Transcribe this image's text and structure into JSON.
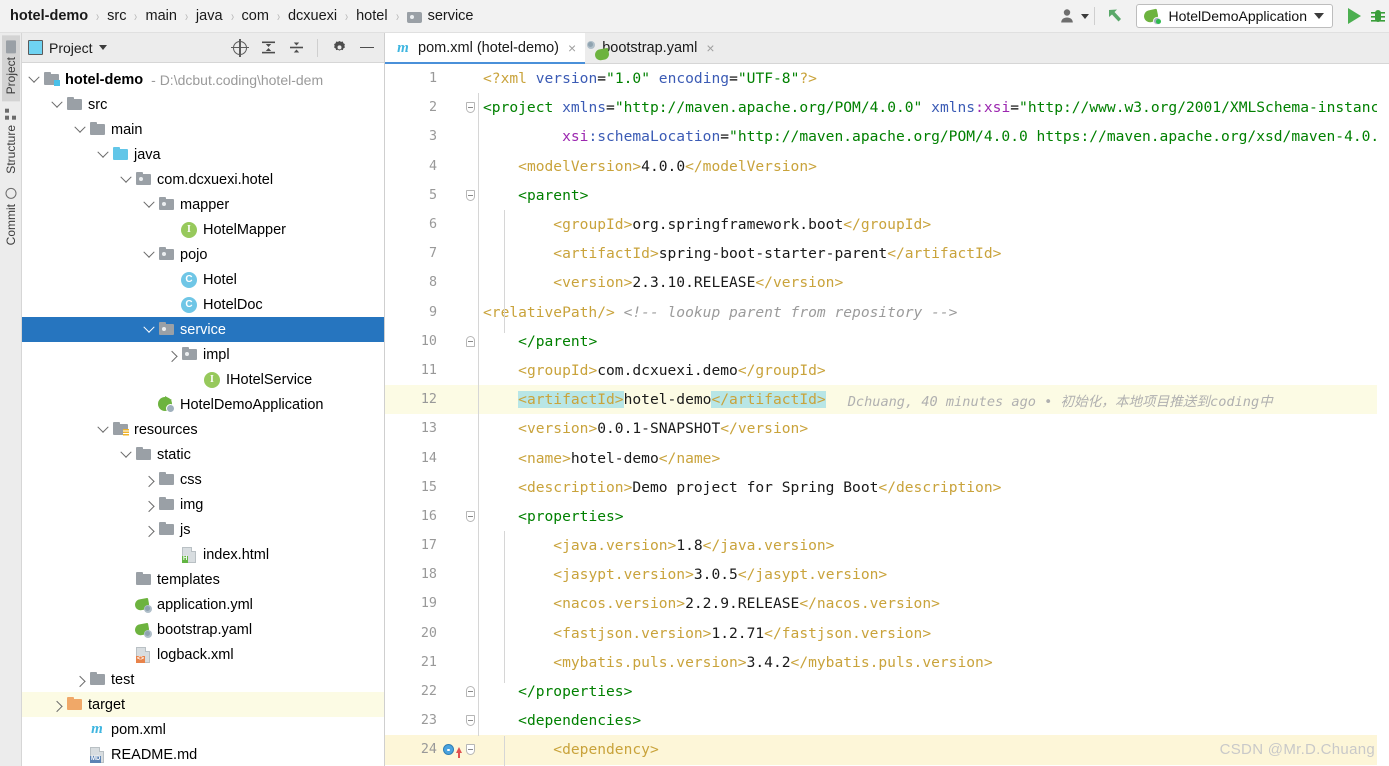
{
  "breadcrumb": {
    "items": [
      "hotel-demo",
      "src",
      "main",
      "java",
      "com",
      "dcxuexi",
      "hotel",
      "service"
    ],
    "separator": "›"
  },
  "toolbar": {
    "account_icon": "user-icon",
    "vcs_update_icon": "vcs-update-arrow-icon",
    "run_config_name": "HotelDemoApplication",
    "run_config_icon": "spring-boot-icon",
    "run_icon": "run-play-icon",
    "debug_icon": "debug-bug-icon"
  },
  "tool_strip": {
    "tabs": [
      {
        "label": "Project",
        "icon": "folder-icon",
        "active": true
      },
      {
        "label": "Structure",
        "icon": "structure-icon",
        "active": false
      },
      {
        "label": "Commit",
        "icon": "commit-icon",
        "active": false
      }
    ]
  },
  "project_panel": {
    "title": "Project",
    "title_icon": "project-window-icon",
    "dropdown_icon": "chevron-down-icon",
    "actions": [
      {
        "name": "locate-file-icon",
        "label": "Select Opened File"
      },
      {
        "name": "expand-all-icon",
        "label": "Expand All"
      },
      {
        "name": "collapse-all-icon",
        "label": "Collapse All"
      },
      {
        "name": "settings-gear-icon",
        "label": "Options"
      },
      {
        "name": "hide-panel-icon",
        "label": "Hide"
      }
    ],
    "tree": [
      {
        "label": "hotel-demo",
        "path": "- D:\\dcbut.coding\\hotel-dem",
        "indent": 0,
        "arrow": "down",
        "icon": "module-folder-icon",
        "bold": true,
        "state": "normal"
      },
      {
        "label": "src",
        "indent": 1,
        "arrow": "down",
        "icon": "folder-icon",
        "state": "normal"
      },
      {
        "label": "main",
        "indent": 2,
        "arrow": "down",
        "icon": "folder-icon",
        "state": "normal"
      },
      {
        "label": "java",
        "indent": 3,
        "arrow": "down",
        "icon": "source-folder-icon",
        "state": "normal"
      },
      {
        "label": "com.dcxuexi.hotel",
        "indent": 4,
        "arrow": "down",
        "icon": "package-icon",
        "state": "normal"
      },
      {
        "label": "mapper",
        "indent": 5,
        "arrow": "down",
        "icon": "package-icon",
        "state": "normal"
      },
      {
        "label": "HotelMapper",
        "indent": 6,
        "arrow": "none",
        "icon": "interface-icon",
        "state": "normal"
      },
      {
        "label": "pojo",
        "indent": 5,
        "arrow": "down",
        "icon": "package-icon",
        "state": "normal"
      },
      {
        "label": "Hotel",
        "indent": 6,
        "arrow": "none",
        "icon": "class-icon",
        "state": "normal"
      },
      {
        "label": "HotelDoc",
        "indent": 6,
        "arrow": "none",
        "icon": "class-icon",
        "state": "normal"
      },
      {
        "label": "service",
        "indent": 5,
        "arrow": "down",
        "icon": "package-icon",
        "state": "selected"
      },
      {
        "label": "impl",
        "indent": 6,
        "arrow": "right",
        "icon": "package-icon",
        "state": "normal"
      },
      {
        "label": "IHotelService",
        "indent": 7,
        "arrow": "none",
        "icon": "interface-icon",
        "state": "normal"
      },
      {
        "label": "HotelDemoApplication",
        "indent": 5,
        "arrow": "none",
        "icon": "spring-boot-class-icon",
        "state": "normal"
      },
      {
        "label": "resources",
        "indent": 3,
        "arrow": "down",
        "icon": "resources-folder-icon",
        "state": "normal"
      },
      {
        "label": "static",
        "indent": 4,
        "arrow": "down",
        "icon": "folder-icon",
        "state": "normal"
      },
      {
        "label": "css",
        "indent": 5,
        "arrow": "right",
        "icon": "folder-icon",
        "state": "normal"
      },
      {
        "label": "img",
        "indent": 5,
        "arrow": "right",
        "icon": "folder-icon",
        "state": "normal"
      },
      {
        "label": "js",
        "indent": 5,
        "arrow": "right",
        "icon": "folder-icon",
        "state": "normal"
      },
      {
        "label": "index.html",
        "indent": 6,
        "arrow": "none",
        "icon": "html-file-icon",
        "state": "normal"
      },
      {
        "label": "templates",
        "indent": 4,
        "arrow": "none",
        "icon": "folder-icon",
        "state": "normal"
      },
      {
        "label": "application.yml",
        "indent": 4,
        "arrow": "none",
        "icon": "spring-yaml-icon",
        "state": "normal"
      },
      {
        "label": "bootstrap.yaml",
        "indent": 4,
        "arrow": "none",
        "icon": "spring-yaml-icon",
        "state": "normal"
      },
      {
        "label": "logback.xml",
        "indent": 4,
        "arrow": "none",
        "icon": "xml-file-icon",
        "state": "normal"
      },
      {
        "label": "test",
        "indent": 2,
        "arrow": "right",
        "icon": "folder-icon",
        "state": "normal"
      },
      {
        "label": "target",
        "indent": 1,
        "arrow": "right",
        "icon": "excluded-folder-icon",
        "state": "highlighted"
      },
      {
        "label": "pom.xml",
        "indent": 2,
        "arrow": "none",
        "icon": "maven-icon",
        "state": "normal"
      },
      {
        "label": "README.md",
        "indent": 2,
        "arrow": "none",
        "icon": "markdown-file-icon",
        "state": "normal"
      }
    ]
  },
  "editor": {
    "tabs": [
      {
        "label": "pom.xml (hotel-demo)",
        "icon": "maven-icon",
        "active": true,
        "close": "×"
      },
      {
        "label": "bootstrap.yaml",
        "icon": "spring-yaml-icon",
        "active": false,
        "close": "×"
      }
    ],
    "blame": {
      "author": "Dchuang",
      "time": "40 minutes ago",
      "separator": "•",
      "message": "初始化，本地项目推送到coding中",
      "full": "Dchuang, 40 minutes ago • 初始化，本地项目推送到coding中"
    },
    "lines": [
      {
        "n": 1,
        "text": "<?xml version=\"1.0\" encoding=\"UTF-8\"?>"
      },
      {
        "n": 2,
        "text": "<project xmlns=\"http://maven.apache.org/POM/4.0.0\" xmlns:xsi=\"http://www.w3.org/2001/XMLSchema-instanc"
      },
      {
        "n": 3,
        "text": "         xsi:schemaLocation=\"http://maven.apache.org/POM/4.0.0 https://maven.apache.org/xsd/maven-4.0."
      },
      {
        "n": 4,
        "text": "    <modelVersion>4.0.0</modelVersion>"
      },
      {
        "n": 5,
        "text": "    <parent>"
      },
      {
        "n": 6,
        "text": "        <groupId>org.springframework.boot</groupId>"
      },
      {
        "n": 7,
        "text": "        <artifactId>spring-boot-starter-parent</artifactId>"
      },
      {
        "n": 8,
        "text": "        <version>2.3.10.RELEASE</version>"
      },
      {
        "n": 9,
        "text": "        <relativePath/> <!-- lookup parent from repository -->"
      },
      {
        "n": 10,
        "text": "    </parent>"
      },
      {
        "n": 11,
        "text": "    <groupId>com.dcxuexi.demo</groupId>"
      },
      {
        "n": 12,
        "text": "    <artifactId>hotel-demo</artifactId>"
      },
      {
        "n": 13,
        "text": "    <version>0.0.1-SNAPSHOT</version>"
      },
      {
        "n": 14,
        "text": "    <name>hotel-demo</name>"
      },
      {
        "n": 15,
        "text": "    <description>Demo project for Spring Boot</description>"
      },
      {
        "n": 16,
        "text": "    <properties>"
      },
      {
        "n": 17,
        "text": "        <java.version>1.8</java.version>"
      },
      {
        "n": 18,
        "text": "        <jasypt.version>3.0.5</jasypt.version>"
      },
      {
        "n": 19,
        "text": "        <nacos.version>2.2.9.RELEASE</nacos.version>"
      },
      {
        "n": 20,
        "text": "        <fastjson.version>1.2.71</fastjson.version>"
      },
      {
        "n": 21,
        "text": "        <mybatis.puls.version>3.4.2</mybatis.puls.version>"
      },
      {
        "n": 22,
        "text": "    </properties>"
      },
      {
        "n": 23,
        "text": "    <dependencies>"
      },
      {
        "n": 24,
        "text": "        <dependency>"
      }
    ]
  },
  "watermark": "CSDN @Mr.D.Chuang",
  "colors": {
    "selection_blue": "#2675bf",
    "highlight_cream": "#fcfbe4",
    "tag_green": "#008000",
    "tag_yellow": "#c9a33b",
    "attr_blue": "#3b5bb5",
    "comment_gray": "#9b9b9b",
    "accent_green": "#6db33f"
  }
}
